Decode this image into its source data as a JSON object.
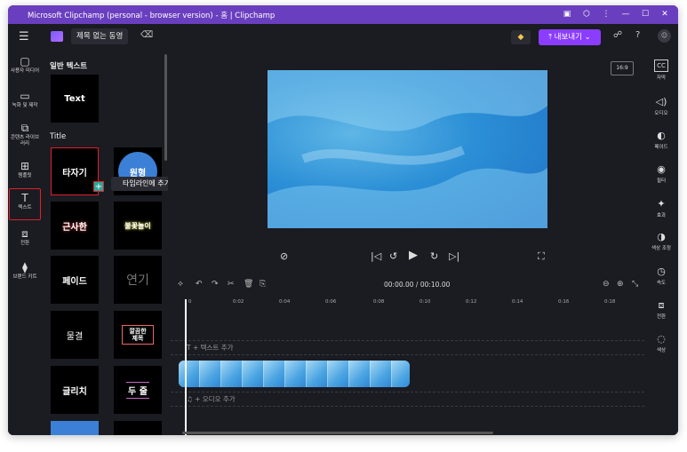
{
  "window": {
    "title": "Microsoft Clipchamp (personal - browser version) - 홈 | Clipchamp"
  },
  "titlebar_icons": [
    "extension-icon",
    "puzzle-icon",
    "more-icon",
    "minimize-icon",
    "maximize-icon",
    "close-icon"
  ],
  "titlebar_glyphs": [
    "▣",
    "⬡",
    "⋮",
    "—",
    "☐",
    "✕"
  ],
  "appbar": {
    "menu_glyph": "☰",
    "project_title": "제목 없는 동영",
    "eraser_glyph": "⌫",
    "gem_glyph": "◆",
    "export_label": "⤒ 내보내기 ⌄",
    "share_glyph": "☍",
    "help_glyph": "?",
    "avatar_glyph": "☺"
  },
  "left_nav": [
    {
      "icon": "▢",
      "label": "사용자 미디어"
    },
    {
      "icon": "▭",
      "label": "녹화 및 제작"
    },
    {
      "icon": "⧉",
      "label": "콘텐츠 라이브러리"
    },
    {
      "icon": "⊞",
      "label": "템플릿"
    },
    {
      "icon": "T",
      "label": "텍스트"
    },
    {
      "icon": "⧈",
      "label": "전환"
    },
    {
      "icon": "⧫",
      "label": "브랜드 키트"
    }
  ],
  "panel": {
    "section_plain": "일반 텍스트",
    "section_title": "Title",
    "plain_tile": "Text",
    "tiles": [
      "타자기",
      "원형",
      "근사한",
      "불꽃놀이",
      "페이드",
      "연기",
      "물결",
      "깔끔한 제목",
      "글리치",
      "두 줄"
    ],
    "add_glyph": "+",
    "tooltip": "타임라인에 추가"
  },
  "right_nav": [
    {
      "icon": "CC",
      "label": "자막"
    },
    {
      "icon": "◁)",
      "label": "오디오"
    },
    {
      "icon": "◐",
      "label": "페이드"
    },
    {
      "icon": "◉",
      "label": "필터"
    },
    {
      "icon": "✦",
      "label": "효과"
    },
    {
      "icon": "◑",
      "label": "색상 조정"
    },
    {
      "icon": "◷",
      "label": "속도"
    },
    {
      "icon": "⧈",
      "label": "전환"
    },
    {
      "icon": "◌",
      "label": "색상"
    }
  ],
  "preview": {
    "aspect_ratio": "16:9",
    "controls": [
      "⊘",
      "|◁",
      "↺",
      "▶",
      "↻",
      "▷|",
      "⛶"
    ]
  },
  "timeline": {
    "tools": [
      "⟡",
      "↶",
      "↷",
      "✂",
      "🗑",
      "⎘"
    ],
    "zoom_out_glyph": "⊖",
    "zoom_in_glyph": "⊕",
    "zoom_fit_glyph": "⤡",
    "time_display": "00:00.00 / 00:10.00",
    "ruler_marks": [
      "0",
      "0:02",
      "0:04",
      "0:06",
      "0:08",
      "0:10",
      "0:12",
      "0:14",
      "0:16",
      "0:18"
    ],
    "text_track_label": "T + 텍스트 추가",
    "audio_track_label": "♫ + 오디오 추가"
  },
  "colors": {
    "accent": "#8b3dff",
    "titlebar": "#6a3fbf",
    "highlight": "#e0202a"
  }
}
